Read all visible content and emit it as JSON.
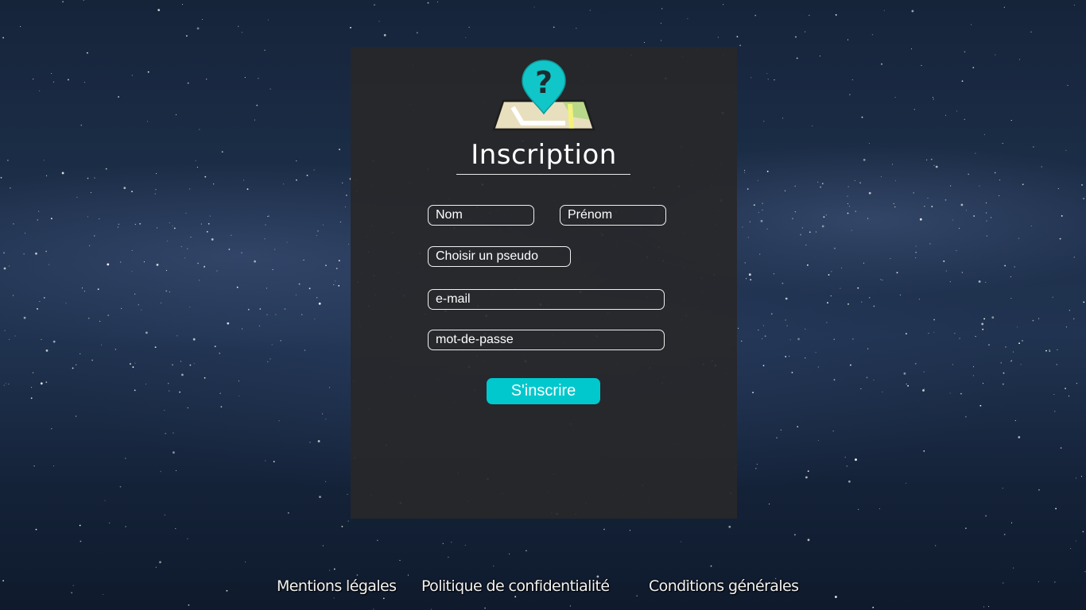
{
  "form": {
    "title": "Inscription",
    "fields": {
      "nom_placeholder": "Nom",
      "prenom_placeholder": "Prénom",
      "pseudo_placeholder": "Choisir un pseudo",
      "email_placeholder": "e-mail",
      "password_placeholder": "mot-de-passe"
    },
    "submit_label": "S'inscrire",
    "logo_icon": "map-question-pin-icon"
  },
  "footer": {
    "links": [
      "Mentions légales",
      "Politique de confidentialité",
      "Conditions générales"
    ]
  },
  "colors": {
    "accent": "#00c8cc",
    "panel": "#28282a",
    "text": "#ffffff"
  }
}
